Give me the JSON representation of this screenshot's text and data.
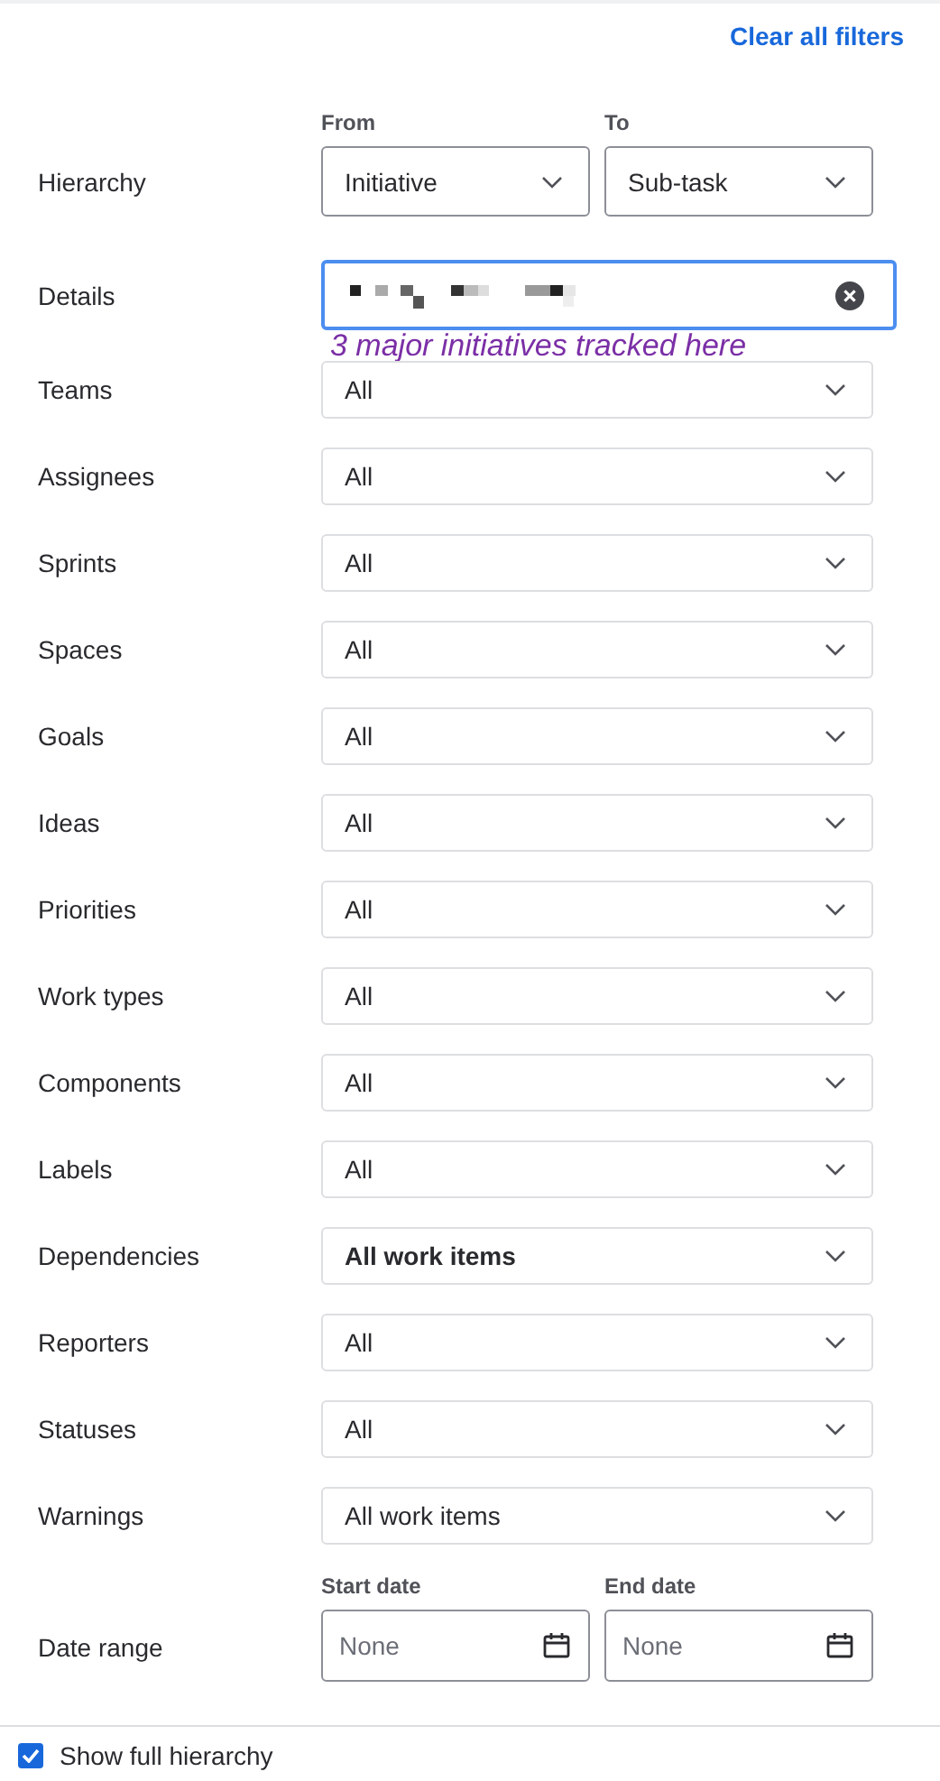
{
  "header": {
    "clear_link": "Clear all filters"
  },
  "hierarchy": {
    "label": "Hierarchy",
    "from": {
      "caption": "From",
      "value": "Initiative"
    },
    "to": {
      "caption": "To",
      "value": "Sub-task"
    }
  },
  "details": {
    "label": "Details",
    "focused": true,
    "annotation": "3 major initiatives tracked here"
  },
  "filters": [
    {
      "label": "Teams",
      "value": "All",
      "bold": false
    },
    {
      "label": "Assignees",
      "value": "All",
      "bold": false
    },
    {
      "label": "Sprints",
      "value": "All",
      "bold": false
    },
    {
      "label": "Spaces",
      "value": "All",
      "bold": false
    },
    {
      "label": "Goals",
      "value": "All",
      "bold": false
    },
    {
      "label": "Ideas",
      "value": "All",
      "bold": false
    },
    {
      "label": "Priorities",
      "value": "All",
      "bold": false
    },
    {
      "label": "Work types",
      "value": "All",
      "bold": false
    },
    {
      "label": "Components",
      "value": "All",
      "bold": false
    },
    {
      "label": "Labels",
      "value": "All",
      "bold": false
    },
    {
      "label": "Dependencies",
      "value": "All work items",
      "bold": true
    },
    {
      "label": "Reporters",
      "value": "All",
      "bold": false
    },
    {
      "label": "Statuses",
      "value": "All",
      "bold": false
    },
    {
      "label": "Warnings",
      "value": "All work items",
      "bold": false
    }
  ],
  "date_range": {
    "label": "Date range",
    "start": {
      "caption": "Start date",
      "placeholder": "None"
    },
    "end": {
      "caption": "End date",
      "placeholder": "None"
    }
  },
  "show_full_hierarchy": {
    "label": "Show full hierarchy",
    "checked": true
  }
}
